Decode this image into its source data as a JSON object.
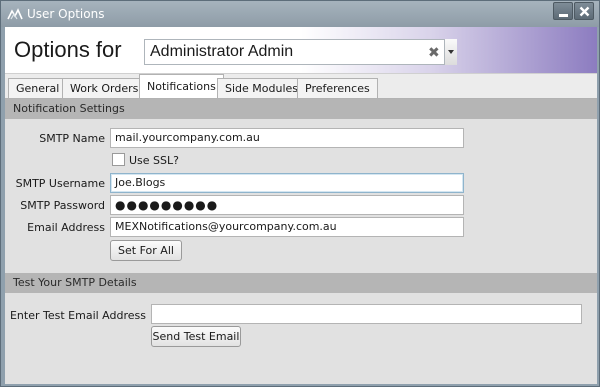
{
  "window": {
    "title": "User Options"
  },
  "header": {
    "title": "Options for",
    "selected_user": "Administrator Admin",
    "clear_glyph": "✖"
  },
  "tabs": [
    {
      "label": "General"
    },
    {
      "label": "Work Orders"
    },
    {
      "label": "Notifications"
    },
    {
      "label": "Side Modules"
    },
    {
      "label": "Preferences"
    }
  ],
  "notification_settings": {
    "heading": "Notification Settings",
    "smtp_name_label": "SMTP Name",
    "smtp_name_value": "mail.yourcompany.com.au",
    "use_ssl_label": "Use SSL?",
    "use_ssl_checked": false,
    "smtp_username_label": "SMTP Username",
    "smtp_username_value": "Joe.Blogs",
    "smtp_password_label": "SMTP Password",
    "smtp_password_mask": "●●●●●●●●●",
    "email_address_label": "Email Address",
    "email_address_value": "MEXNotifications@yourcompany.com.au",
    "set_for_all_label": "Set For All"
  },
  "test_smtp": {
    "heading": "Test Your SMTP Details",
    "test_email_label": "Enter Test Email Address",
    "test_email_value": "",
    "send_button_label": "Send Test Email"
  },
  "icons": [
    "app-logo-icon",
    "minimize-icon",
    "close-icon",
    "clear-icon",
    "chevron-down-icon"
  ]
}
